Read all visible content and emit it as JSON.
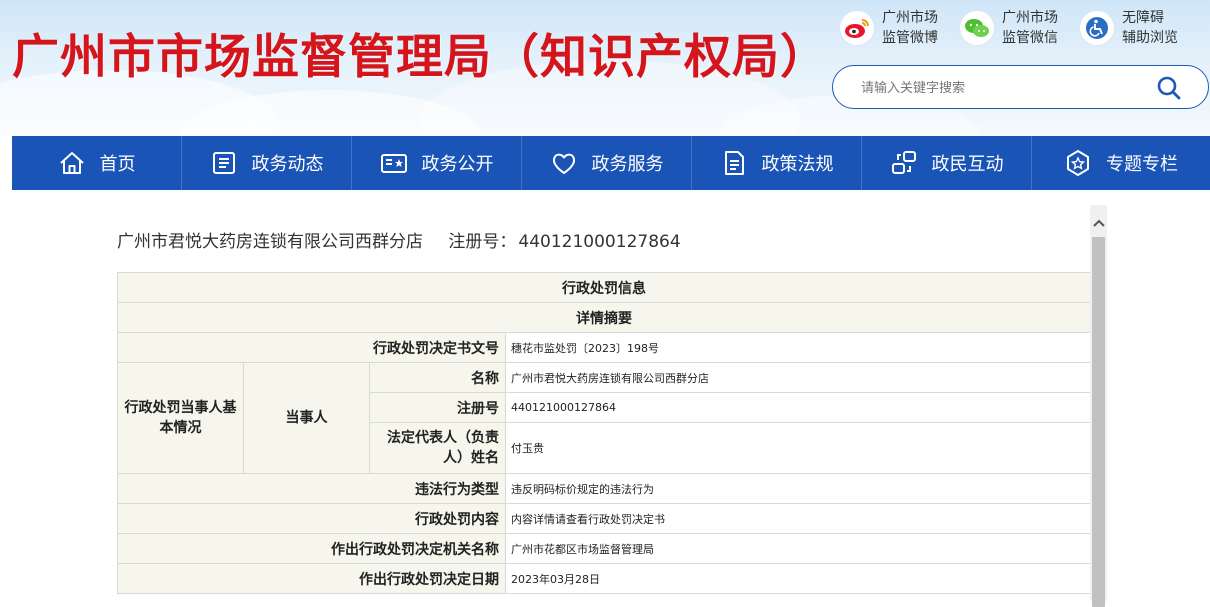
{
  "header": {
    "site_title": "广州市市场监督管理局（知识产权局）",
    "quick_links": [
      {
        "line1": "广州市场",
        "line2": "监管微博",
        "icon": "weibo-icon",
        "color": "#e6162d"
      },
      {
        "line1": "广州市场",
        "line2": "监管微信",
        "icon": "wechat-icon",
        "color": "#4cbf2f"
      },
      {
        "line1": "无障碍",
        "line2": "辅助浏览",
        "icon": "accessibility-icon",
        "color": "#2b6cc4"
      }
    ],
    "search": {
      "placeholder": "请输入关键字搜索",
      "icon": "search-icon"
    }
  },
  "nav": {
    "items": [
      {
        "label": "首页",
        "icon": "home-icon"
      },
      {
        "label": "政务动态",
        "icon": "news-icon"
      },
      {
        "label": "政务公开",
        "icon": "open-info-icon"
      },
      {
        "label": "政务服务",
        "icon": "heart-icon"
      },
      {
        "label": "政策法规",
        "icon": "document-icon"
      },
      {
        "label": "政民互动",
        "icon": "interaction-icon"
      },
      {
        "label": "专题专栏",
        "icon": "star-badge-icon"
      }
    ],
    "color": "#1a54b7"
  },
  "record": {
    "company_name": "广州市君悦大药房连锁有限公司西群分店",
    "reg_label": "注册号：",
    "reg_number": "440121000127864"
  },
  "table": {
    "title": "行政处罚信息",
    "subtitle": "详情摘要",
    "rows": {
      "decision_no": {
        "label": "行政处罚决定书文号",
        "value": "穗花市监处罚〔2023〕198号"
      },
      "party_group": "行政处罚当事人基本情况",
      "party": "当事人",
      "name": {
        "label": "名称",
        "value": "广州市君悦大药房连锁有限公司西群分店"
      },
      "reg_no": {
        "label": "注册号",
        "value": "440121000127864"
      },
      "legal_rep": {
        "label": "法定代表人（负责人）姓名",
        "value": "付玉贵"
      },
      "violation_type": {
        "label": "违法行为类型",
        "value": "违反明码标价规定的违法行为"
      },
      "penalty_content": {
        "label": "行政处罚内容",
        "value": "内容详情请查看行政处罚决定书"
      },
      "authority": {
        "label": "作出行政处罚决定机关名称",
        "value": "广州市花都区市场监督管理局"
      },
      "decision_date": {
        "label": "作出行政处罚决定日期",
        "value": "2023年03月28日"
      }
    }
  }
}
